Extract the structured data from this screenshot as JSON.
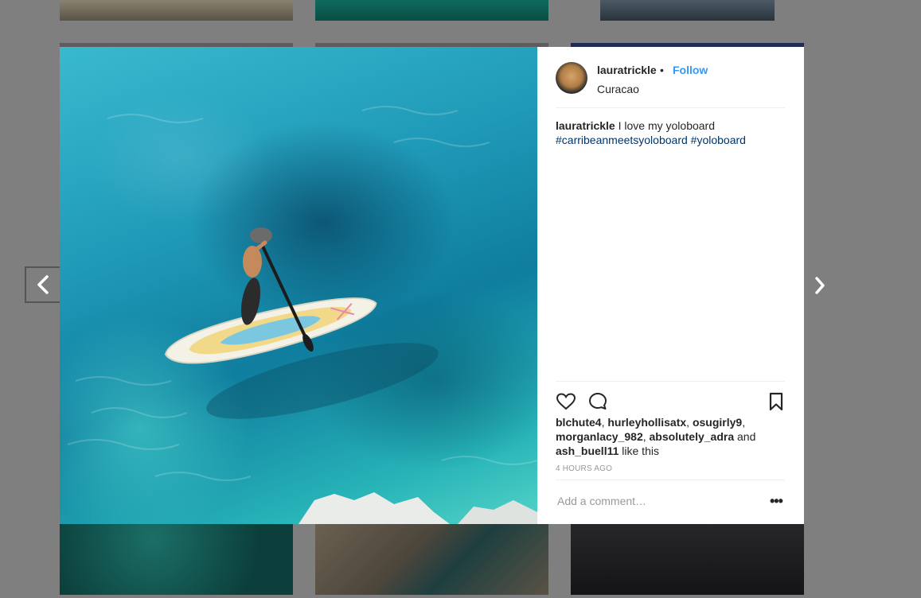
{
  "post": {
    "username": "lauratrickle",
    "separator": "•",
    "follow_label": "Follow",
    "location": "Curacao",
    "caption": {
      "username": "lauratrickle",
      "text": "I love my yoloboard",
      "hashtags": [
        "#carribeanmeetsyoloboard",
        "#yoloboard"
      ]
    },
    "likes": {
      "users": [
        "blchute4",
        "hurleyhollisatx",
        "osugirly9",
        "morganlacy_982",
        "absolutely_adra",
        "ash_buell11"
      ],
      "and_word": "and",
      "suffix": "like this"
    },
    "timestamp": "4 HOURS AGO",
    "comment_placeholder": "Add a comment…",
    "more_label": "•••"
  },
  "navigation": {
    "prev_icon": "chevron-left-icon",
    "next_icon": "chevron-right-icon"
  },
  "colors": {
    "link_blue": "#3897f0",
    "hashtag": "#003569",
    "text": "#262626",
    "muted": "#999999",
    "overlay": "#7f7f7f"
  }
}
